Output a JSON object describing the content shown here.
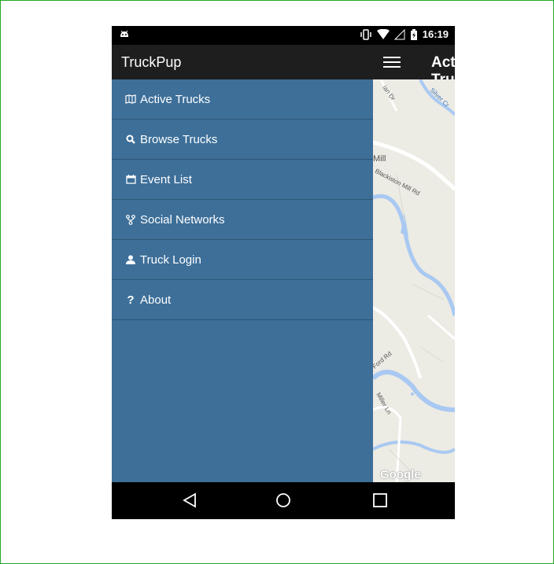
{
  "status_bar": {
    "time": "16:19"
  },
  "app": {
    "title": "TruckPup",
    "page_title": "Active Trucks"
  },
  "drawer": {
    "items": [
      {
        "label": "Active Trucks",
        "icon": "map-icon"
      },
      {
        "label": "Browse Trucks",
        "icon": "search-icon"
      },
      {
        "label": "Event List",
        "icon": "calendar-icon"
      },
      {
        "label": "Social Networks",
        "icon": "fork-icon"
      },
      {
        "label": "Truck Login",
        "icon": "user-icon"
      },
      {
        "label": "About",
        "icon": "question-icon"
      }
    ]
  },
  "map": {
    "attribution": "Google",
    "labels": [
      "Mill",
      "Blackiston Mill Rd",
      "Silver Cr",
      "Ford Rd",
      "Miller Ln",
      "ian Dr"
    ]
  },
  "colors": {
    "drawer_bg": "#3d6f99",
    "appbar_bg": "#1e1e1e",
    "map_road": "#ffffff",
    "map_water": "#a9c9f2"
  }
}
